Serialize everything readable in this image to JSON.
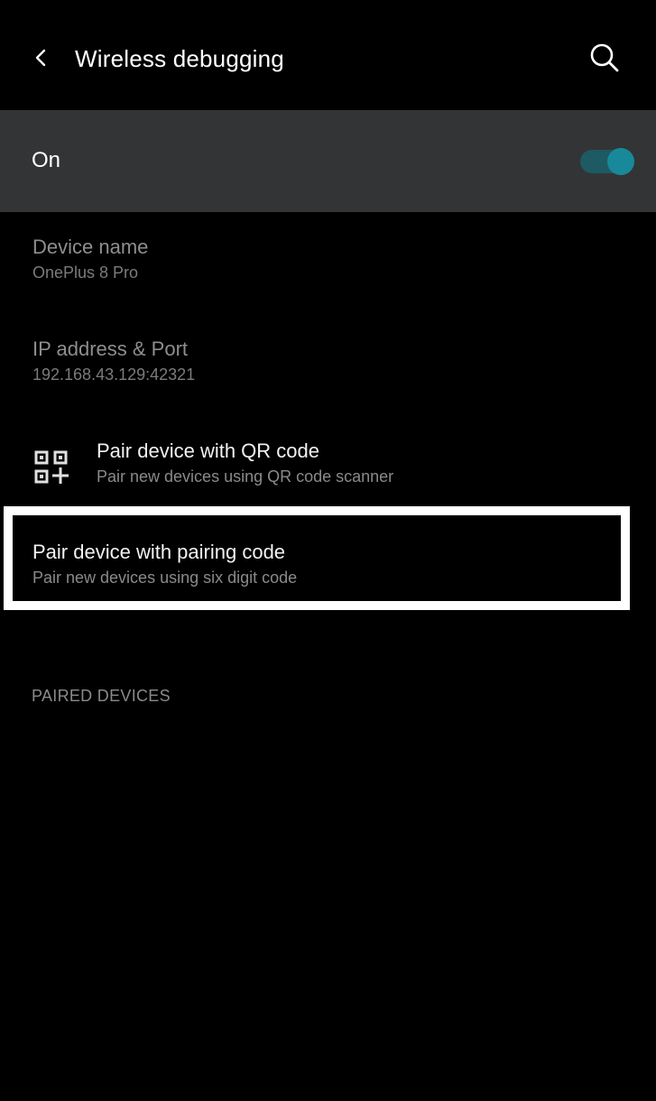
{
  "header": {
    "title": "Wireless debugging",
    "back_icon": "chevron-left-icon",
    "search_icon": "search-icon"
  },
  "master_switch": {
    "label": "On",
    "state": true,
    "accent_color": "#18899a"
  },
  "items": [
    {
      "title": "Device name",
      "summary": "OnePlus 8 Pro"
    },
    {
      "title": "IP address & Port",
      "summary": "192.168.43.129:42321"
    },
    {
      "title": "Pair device with QR code",
      "summary": "Pair new devices using QR code scanner",
      "icon": "qr-code-icon"
    },
    {
      "title": "Pair device with pairing code",
      "summary": "Pair new devices using six digit code"
    }
  ],
  "paired_devices": {
    "header": "PAIRED DEVICES"
  }
}
